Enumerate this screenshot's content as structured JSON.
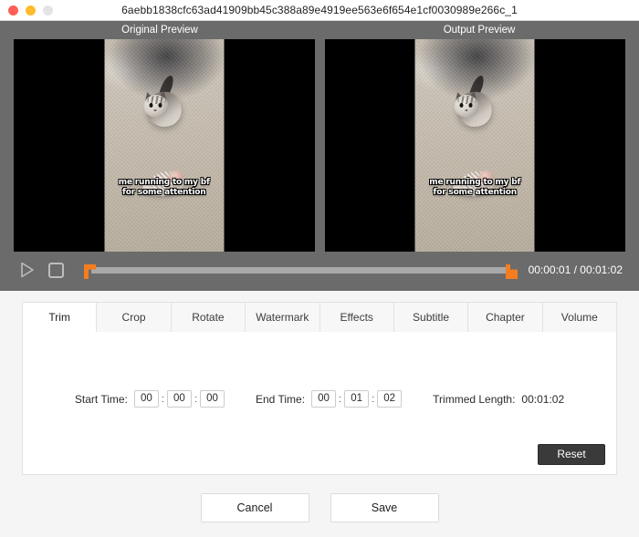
{
  "window": {
    "title": "6aebb1838cfc63ad41909bb45c388a89e4919ee563e6f654e1cf0030989e266c_1",
    "controls": {
      "close": "close-button",
      "minimize": "minimize-button",
      "zoom": "zoom-button"
    }
  },
  "preview": {
    "original_label": "Original Preview",
    "output_label": "Output  Preview",
    "caption_line1": "me running to my bf",
    "caption_line2": "for some attention"
  },
  "transport": {
    "play_icon": "play-icon",
    "stop_icon": "stop-icon",
    "timecode": "00:00:01 / 00:01:02",
    "current_time": "00:00:01",
    "total_time": "00:01:02",
    "trim_start_handle": "trim-start-handle",
    "trim_end_handle": "trim-end-handle",
    "handle_color": "#f57d20"
  },
  "tabs": [
    {
      "label": "Trim",
      "active": true
    },
    {
      "label": "Crop",
      "active": false
    },
    {
      "label": "Rotate",
      "active": false
    },
    {
      "label": "Watermark",
      "active": false
    },
    {
      "label": "Effects",
      "active": false
    },
    {
      "label": "Subtitle",
      "active": false
    },
    {
      "label": "Chapter",
      "active": false
    },
    {
      "label": "Volume",
      "active": false
    }
  ],
  "trim": {
    "start_label": "Start Time:",
    "start_hours": "00",
    "start_minutes": "00",
    "start_seconds": "00",
    "end_label": "End Time:",
    "end_hours": "00",
    "end_minutes": "01",
    "end_seconds": "02",
    "length_label": "Trimmed Length:",
    "length_value": "00:01:02",
    "separator": ":",
    "reset_label": "Reset"
  },
  "footer": {
    "cancel_label": "Cancel",
    "save_label": "Save"
  }
}
